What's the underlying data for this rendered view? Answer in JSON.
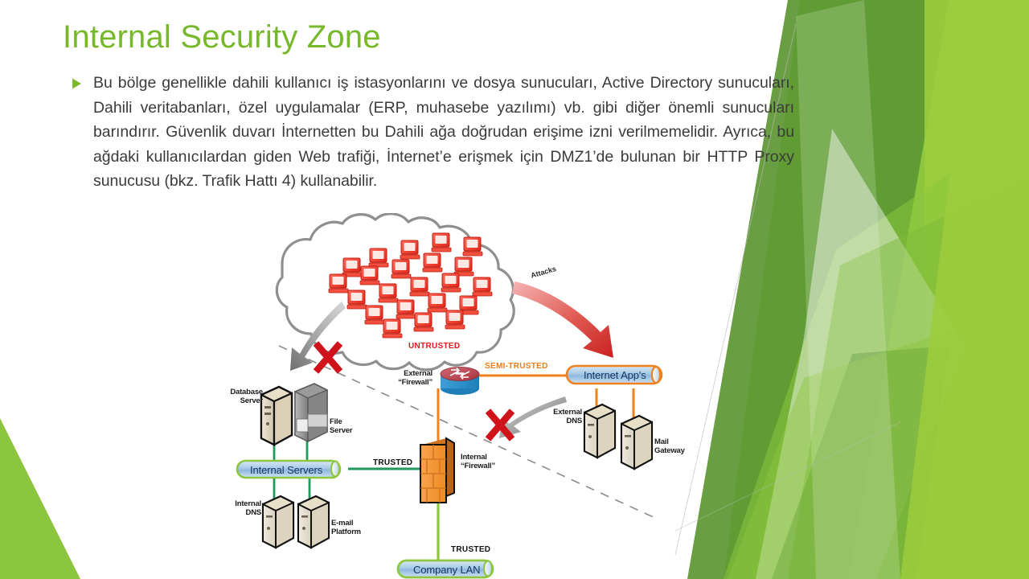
{
  "slide": {
    "title": "Internal Security Zone",
    "title_color": "#77b82a",
    "body_text": "Bu bölge genellikle dahili kullanıcı iş istasyonlarını ve dosya sunucuları, Active Directory sunucuları, Dahili veritabanları, özel uygulamalar (ERP, muhasebe yazılımı) vb. gibi diğer önemli sunucuları barındırır. Güvenlik duvarı İnternetten bu Dahili ağa doğrudan erişime izni verilmemelidir. Ayrıca, bu ağdaki kullanıcılardan giden Web trafiği, İnternet’e erişmek için DMZ1’de bulunan bir HTTP Proxy sunucusu (bkz. Trafik Hattı 4) kullanabilir.",
    "bullet_icon": "triangle-bullet-icon",
    "bullet_color": "#7cb82f"
  },
  "diagram": {
    "name": "network-security-zones-diagram",
    "zones": {
      "untrusted": "UNTRUSTED",
      "semi_trusted": "SEMI-TRUSTED",
      "trusted_internal": "TRUSTED",
      "trusted_lan": "TRUSTED"
    },
    "labels": {
      "attacks": "Attacks",
      "external_firewall": "External\n“Firewall”",
      "internal_firewall": "Internal\n“Firewall”",
      "database_server": "Database\nServer",
      "file_server": "File\nServer",
      "internal_dns": "Internal\nDNS",
      "email_platform": "E-mail\nPlatform",
      "external_dns": "External\nDNS",
      "mail_gateway": "Mail\nGateway"
    },
    "bars": {
      "internet_apps": "Internet App's",
      "internal_servers": "Internal Servers",
      "company_lan": "Company LAN"
    },
    "colors": {
      "untrusted": "#e8161b",
      "semi_trusted": "#f07d18",
      "trusted": "#111111",
      "link_orange": "#f0821e",
      "link_green": "#1f9a5e",
      "link_lan_green": "#8dc63f",
      "attack_arrow": "#d32b2b",
      "blocked_x": "#d0121b",
      "bar_fill": "#9ec3e6",
      "bar_border_orange": "#f0821e",
      "bar_border_green": "#8dc63f",
      "cloud_stroke": "#8a8a8a",
      "dashed_divider": "#7a7a7a"
    },
    "icons": {
      "cloud": "cloud-icon",
      "router": "router-icon",
      "brick_wall": "firewall-brick-icon",
      "server": "server-icon",
      "blocked": "blocked-x-icon",
      "attack_arrow": "attack-arrow-icon",
      "blocked_arrow": "blocked-arrow-icon"
    },
    "cloud_hosts_count": 24
  }
}
